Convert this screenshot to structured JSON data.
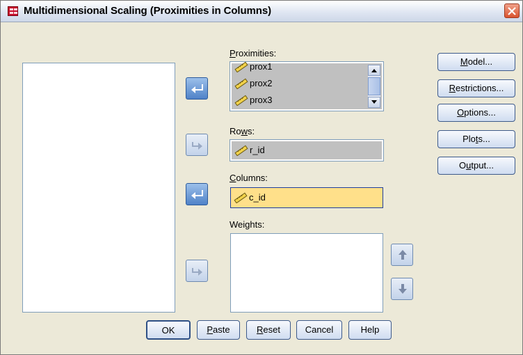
{
  "window": {
    "title": "Multidimensional Scaling (Proximities in Columns)"
  },
  "fields": {
    "proximities": {
      "label_pre": "",
      "label_u": "P",
      "label_post": "roximities:",
      "items": [
        "prox1",
        "prox2",
        "prox3"
      ]
    },
    "rows": {
      "label_pre": "Ro",
      "label_u": "w",
      "label_post": "s:",
      "items": [
        "r_id"
      ]
    },
    "columns": {
      "label_pre": "",
      "label_u": "C",
      "label_post": "olumns:",
      "items": [
        "c_id"
      ]
    },
    "weights": {
      "label_pre": "Wei",
      "label_u": "g",
      "label_post": "hts:",
      "items": []
    }
  },
  "side_buttons": [
    {
      "pre": "",
      "u": "M",
      "post": "odel..."
    },
    {
      "pre": "",
      "u": "R",
      "post": "estrictions..."
    },
    {
      "pre": "",
      "u": "O",
      "post": "ptions..."
    },
    {
      "pre": "Plo",
      "u": "t",
      "post": "s..."
    },
    {
      "pre": "O",
      "u": "u",
      "post": "tput..."
    }
  ],
  "bottom_buttons": [
    {
      "pre": "OK",
      "u": "",
      "post": ""
    },
    {
      "pre": "",
      "u": "P",
      "post": "aste"
    },
    {
      "pre": "",
      "u": "R",
      "post": "eset"
    },
    {
      "pre": "Cancel",
      "u": "",
      "post": ""
    },
    {
      "pre": "Help",
      "u": "",
      "post": ""
    }
  ],
  "colors": {
    "selected_field": "#ffe08a",
    "active_arrow": "#4f82c8",
    "title_bar": "#dfe6f2"
  }
}
